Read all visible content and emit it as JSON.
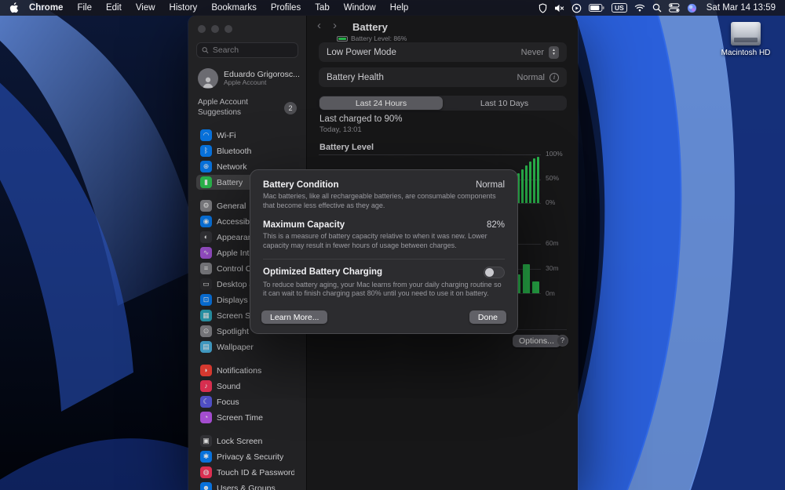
{
  "colors": {
    "accent_green": "#30d158",
    "wallpaper_blue": "#2f6ae8",
    "segment_selected": "#68686e"
  },
  "menu_bar": {
    "app_name": "Chrome",
    "items": [
      "File",
      "Edit",
      "View",
      "History",
      "Bookmarks",
      "Profiles",
      "Tab",
      "Window",
      "Help"
    ],
    "keyboard_badge": "US",
    "clock": "Sat Mar 14 13:59"
  },
  "desktop": {
    "hdd_label": "Macintosh HD"
  },
  "sidebar": {
    "search_placeholder": "Search",
    "account_name": "Eduardo Grigorosc...",
    "account_subtitle": "Apple Account",
    "suggestions_label": "Apple Account Suggestions",
    "suggestions_badge": "2",
    "items": [
      {
        "name": "sidebar-item-wifi",
        "label": "Wi-Fi",
        "glyph": "◠",
        "color": "#0a84ff"
      },
      {
        "name": "sidebar-item-bluetooth",
        "label": "Bluetooth",
        "glyph": "ᛒ",
        "color": "#0a84ff"
      },
      {
        "name": "sidebar-item-network",
        "label": "Network",
        "glyph": "⊕",
        "color": "#0a84ff"
      },
      {
        "name": "sidebar-item-battery",
        "label": "Battery",
        "glyph": "▮",
        "color": "#30d158",
        "cls": "selected"
      },
      {
        "name": "sidebar-item-general",
        "label": "General",
        "glyph": "⚙",
        "color": "#8e8e93",
        "cls": "gap"
      },
      {
        "name": "sidebar-item-accessibility",
        "label": "Accessibility",
        "glyph": "◉",
        "color": "#0a84ff"
      },
      {
        "name": "sidebar-item-appearance",
        "label": "Appearance",
        "glyph": "◐",
        "color": "#3a3a3e"
      },
      {
        "name": "sidebar-item-apple-intelligence",
        "label": "Apple Intelli...",
        "glyph": "∿",
        "color": "#b05be8"
      },
      {
        "name": "sidebar-item-control-center",
        "label": "Control Ce...",
        "glyph": "≡",
        "color": "#8e8e93"
      },
      {
        "name": "sidebar-item-desktop-dock",
        "label": "Desktop & ...",
        "glyph": "▭",
        "color": "#303034"
      },
      {
        "name": "sidebar-item-displays",
        "label": "Displays",
        "glyph": "⊡",
        "color": "#0a84ff"
      },
      {
        "name": "sidebar-item-screen-saver",
        "label": "Screen Sav...",
        "glyph": "▦",
        "color": "#30b0c7"
      },
      {
        "name": "sidebar-item-spotlight",
        "label": "Spotlight",
        "glyph": "⊙",
        "color": "#8e8e93"
      },
      {
        "name": "sidebar-item-wallpaper",
        "label": "Wallpaper",
        "glyph": "▤",
        "color": "#4db8e8"
      },
      {
        "name": "sidebar-item-notifications",
        "label": "Notifications",
        "glyph": "◗",
        "color": "#ff453a",
        "cls": "gap"
      },
      {
        "name": "sidebar-item-sound",
        "label": "Sound",
        "glyph": "♪",
        "color": "#ff375f"
      },
      {
        "name": "sidebar-item-focus",
        "label": "Focus",
        "glyph": "☾",
        "color": "#5e5ce6"
      },
      {
        "name": "sidebar-item-screen-time",
        "label": "Screen Time",
        "glyph": "◔",
        "color": "#bf5af2"
      },
      {
        "name": "sidebar-item-lock-screen",
        "label": "Lock Screen",
        "glyph": "▣",
        "color": "#3a3a3e",
        "cls": "gap"
      },
      {
        "name": "sidebar-item-privacy-security",
        "label": "Privacy & Security",
        "glyph": "✱",
        "color": "#0a84ff"
      },
      {
        "name": "sidebar-item-touch-id",
        "label": "Touch ID & Password",
        "glyph": "◍",
        "color": "#ff375f"
      },
      {
        "name": "sidebar-item-users-groups",
        "label": "Users & Groups",
        "glyph": "☻",
        "color": "#0a84ff"
      }
    ]
  },
  "battery_pane": {
    "title": "Battery",
    "subtitle": "Battery Level: 86%",
    "low_power_label": "Low Power Mode",
    "low_power_value": "Never",
    "health_label": "Battery Health",
    "health_value": "Normal",
    "tabs": [
      {
        "label": "Last 24 Hours",
        "cls": "selected"
      },
      {
        "label": "Last 10 Days"
      }
    ],
    "last_charged_title": "Last charged to 90%",
    "last_charged_subtitle": "Today, 13:01",
    "chart_heading": "Battery Level",
    "level_ticks": [
      "100%",
      "50%",
      "0%"
    ],
    "usage_ticks": [
      "60m",
      "30m",
      "0m"
    ],
    "options_button": "Options...",
    "help_button": "?"
  },
  "level_bars": [
    "38%",
    "46%",
    "54%",
    "60%",
    "68%",
    "76%",
    "84%",
    "90%",
    "93%"
  ],
  "usage_bars": [
    "38%",
    "58%",
    "24%"
  ],
  "dialog": {
    "condition_title": "Battery Condition",
    "condition_value": "Normal",
    "condition_desc": "Mac batteries, like all rechargeable batteries, are consumable components that become less effective as they age.",
    "capacity_title": "Maximum Capacity",
    "capacity_value": "82%",
    "capacity_desc": "This is a measure of battery capacity relative to when it was new. Lower capacity may result in fewer hours of usage between charges.",
    "optimized_title": "Optimized Battery Charging",
    "optimized_desc": "To reduce battery aging, your Mac learns from your daily charging routine so it can wait to finish charging past 80% until you need to use it on battery.",
    "learn_more": "Learn More...",
    "done": "Done"
  },
  "chart_data": [
    {
      "type": "bar",
      "title": "Battery Level",
      "period_tab": "Last 24 Hours",
      "ytick_labels": [
        "100%",
        "50%",
        "0%"
      ],
      "ylim": [
        0,
        100
      ],
      "values_visible_pct": [
        38,
        46,
        54,
        60,
        68,
        76,
        84,
        90,
        93
      ],
      "series_color": "#30d158",
      "grid": true,
      "legend": false
    },
    {
      "type": "bar",
      "title": "",
      "ytick_labels": [
        "60m",
        "30m",
        "0m"
      ],
      "ylim_minutes": [
        0,
        60
      ],
      "values_visible_minutes": [
        23,
        35,
        14
      ],
      "series_color": "#30d158",
      "grid": true,
      "legend": false
    }
  ]
}
